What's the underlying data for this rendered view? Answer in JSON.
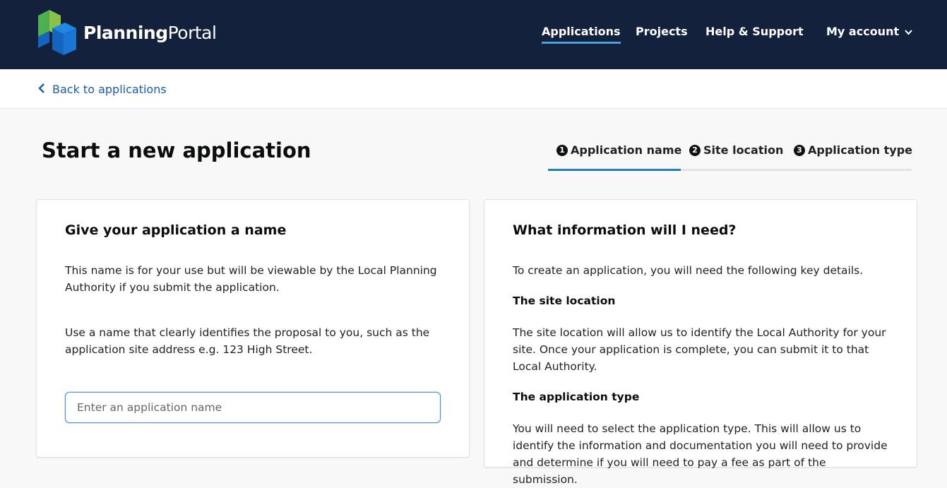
{
  "brand": {
    "name_bold": "Planning",
    "name_light": "Portal"
  },
  "nav": {
    "applications": "Applications",
    "projects": "Projects",
    "help": "Help & Support",
    "account": "My account"
  },
  "back": {
    "label": "Back to applications"
  },
  "page": {
    "title": "Start a new application"
  },
  "steps": [
    {
      "num": "1",
      "label": "Application name",
      "active": true
    },
    {
      "num": "2",
      "label": "Site location"
    },
    {
      "num": "3",
      "label": "Application type"
    }
  ],
  "left_card": {
    "heading": "Give your application a name",
    "para1": "This name is for your use but will be viewable by the Local Planning Authority if you submit the application.",
    "para2": "Use a name that clearly identifies the proposal to you, such as the application site address e.g. 123 High Street.",
    "input_placeholder": "Enter an application name",
    "input_value": ""
  },
  "right_card": {
    "heading": "What information will I need?",
    "intro": "To create an application, you will need the following key details.",
    "site_heading": "The site location",
    "site_text": "The site location will allow us to identify the Local Authority for your site. Once your application is complete, you can submit it to that Local Authority.",
    "type_heading": "The application type",
    "type_text": "You will need to select the application type. This will allow us to identify the information and documentation you will need to provide and determine if you will need to pay a fee as part of the submission."
  },
  "colors": {
    "header_bg": "#14213d",
    "accent": "#4aa3df",
    "link": "#1d5aa5",
    "active_step": "#1f7fc4"
  }
}
